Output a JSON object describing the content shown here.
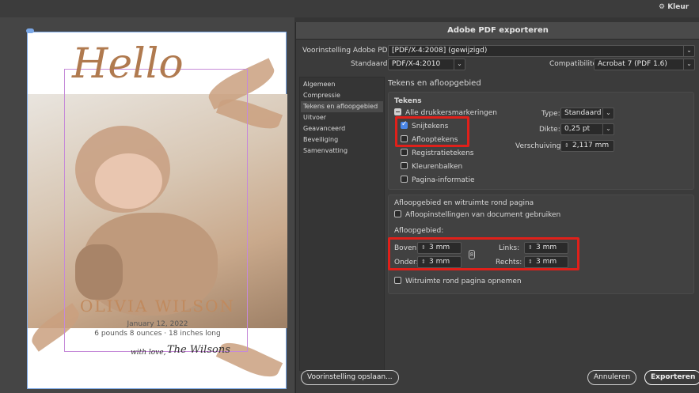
{
  "topright": {
    "label": "Kleur"
  },
  "document": {
    "hello": "Hello",
    "name": "OLIVIA WILSON",
    "date": "January 12, 2022",
    "details": "6 pounds 8 ounces · 18 inches long",
    "signoff_a": "with love,",
    "signoff_b": "The Wilsons"
  },
  "dialog": {
    "title": "Adobe PDF exporteren",
    "preset_label": "Voorinstelling Adobe PDF:",
    "preset_value": "[PDF/X-4:2008] (gewijzigd)",
    "standard_label": "Standaard:",
    "standard_value": "PDF/X-4:2010",
    "compat_label": "Compatibiliteit:",
    "compat_value": "Acrobat 7 (PDF 1.6)",
    "sidebar": [
      "Algemeen",
      "Compressie",
      "Tekens en afloopgebied",
      "Uitvoer",
      "Geavanceerd",
      "Beveiliging",
      "Samenvatting"
    ],
    "section_title": "Tekens en afloopgebied",
    "marks": {
      "title": "Tekens",
      "all": "Alle drukkersmarkeringen",
      "crop": "Snijtekens",
      "bleed": "Aflooptekens",
      "registration": "Registratietekens",
      "colorbars": "Kleurenbalken",
      "pageinfo": "Pagina-informatie",
      "type_label": "Type:",
      "type_value": "Standaard",
      "weight_label": "Dikte:",
      "weight_value": "0,25 pt",
      "offset_label": "Verschuiving:",
      "offset_value": "2,117 mm"
    },
    "bleed": {
      "title": "Afloopgebied en witruimte rond pagina",
      "use_doc": "Afloopinstellingen van document gebruiken",
      "area_label": "Afloopgebied:",
      "top_label": "Boven:",
      "top_value": "3 mm",
      "bottom_label": "Onder:",
      "bottom_value": "3 mm",
      "left_label": "Links:",
      "left_value": "3 mm",
      "right_label": "Rechts:",
      "right_value": "3 mm",
      "slug": "Witruimte rond pagina opnemen"
    },
    "buttons": {
      "save_preset": "Voorinstelling opslaan...",
      "cancel": "Annuleren",
      "export": "Exporteren"
    }
  }
}
